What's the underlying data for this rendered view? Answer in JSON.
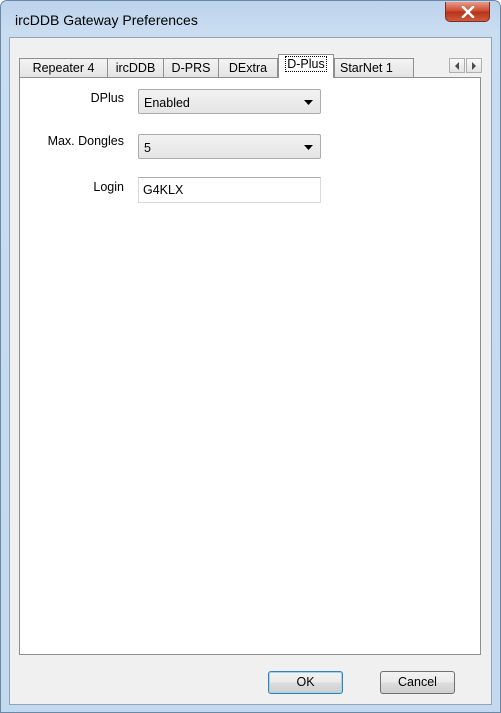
{
  "window": {
    "title": "ircDDB Gateway Preferences"
  },
  "tabs": [
    {
      "label": "Repeater 4"
    },
    {
      "label": "ircDDB"
    },
    {
      "label": "D-PRS"
    },
    {
      "label": "DExtra"
    },
    {
      "label": "D-Plus",
      "active": true
    },
    {
      "label": "StarNet 1"
    }
  ],
  "form": {
    "dplus": {
      "label": "DPlus",
      "value": "Enabled"
    },
    "max_dongles": {
      "label": "Max. Dongles",
      "value": "5"
    },
    "login": {
      "label": "Login",
      "value": "G4KLX"
    }
  },
  "buttons": {
    "ok": "OK",
    "cancel": "Cancel"
  },
  "icons": {
    "close": "close-icon",
    "scroll_left": "chevron-left-icon",
    "scroll_right": "chevron-right-icon",
    "dropdown": "chevron-down-icon"
  }
}
